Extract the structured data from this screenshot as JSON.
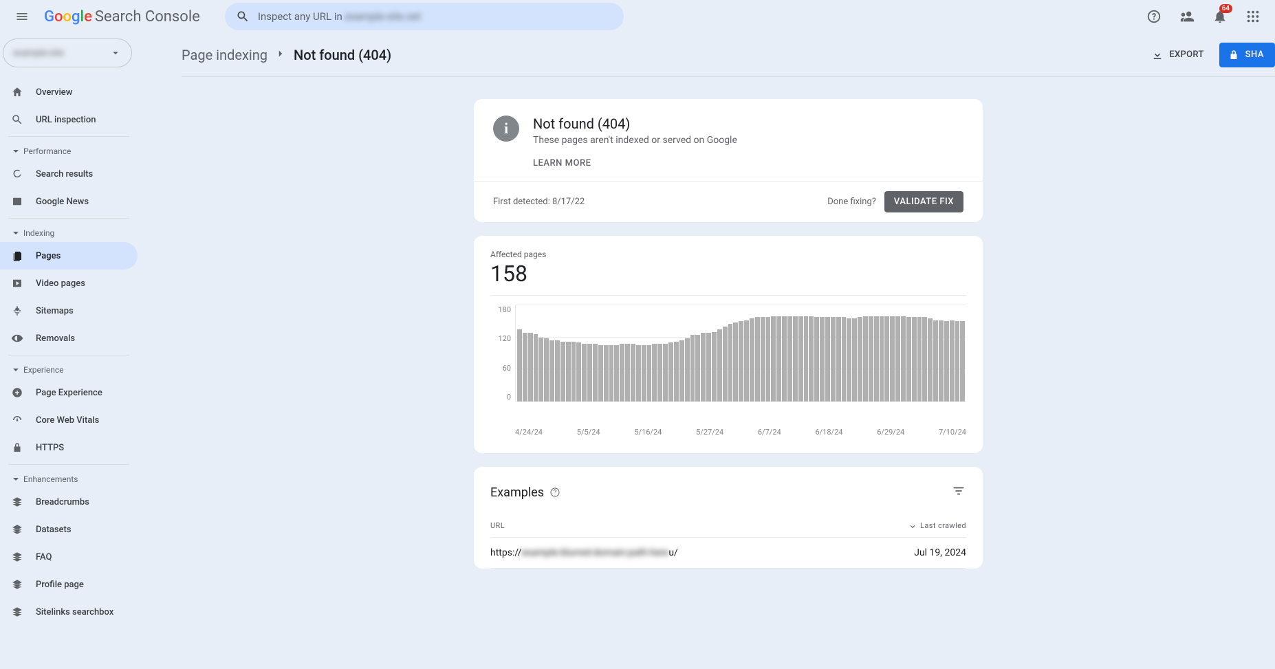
{
  "header": {
    "product_name": "Search Console",
    "search_placeholder": "Inspect any URL in",
    "search_domain_blurred": "example-site.net",
    "notification_count": "64"
  },
  "property_selector": {
    "blurred_text": "example-site"
  },
  "sidebar": {
    "overview": "Overview",
    "url_inspection": "URL inspection",
    "section_performance": "Performance",
    "search_results": "Search results",
    "google_news": "Google News",
    "section_indexing": "Indexing",
    "pages": "Pages",
    "video_pages": "Video pages",
    "sitemaps": "Sitemaps",
    "removals": "Removals",
    "section_experience": "Experience",
    "page_experience": "Page Experience",
    "core_web_vitals": "Core Web Vitals",
    "https": "HTTPS",
    "section_enhancements": "Enhancements",
    "breadcrumbs": "Breadcrumbs",
    "datasets": "Datasets",
    "faq": "FAQ",
    "profile_page": "Profile page",
    "sitelinks_searchbox": "Sitelinks searchbox"
  },
  "breadcrumb": {
    "parent": "Page indexing",
    "current": "Not found (404)",
    "export": "EXPORT",
    "share": "SHA"
  },
  "status_card": {
    "title": "Not found (404)",
    "subtitle": "These pages aren't indexed or served on Google",
    "learn_more": "LEARN MORE",
    "first_detected_label": "First detected: ",
    "first_detected_date": "8/17/22",
    "done_fixing": "Done fixing?",
    "validate": "VALIDATE FIX"
  },
  "chart_card": {
    "label": "Affected pages",
    "value": "158"
  },
  "chart_data": {
    "type": "bar",
    "title": "Affected pages",
    "ylabel": "",
    "xlabel": "",
    "ylim": [
      0,
      180
    ],
    "y_ticks": [
      "180",
      "120",
      "60",
      "0"
    ],
    "x_ticks": [
      "4/24/24",
      "5/5/24",
      "5/16/24",
      "5/27/24",
      "6/7/24",
      "6/18/24",
      "6/29/24",
      "7/10/24"
    ],
    "values": [
      135,
      128,
      128,
      126,
      120,
      118,
      115,
      115,
      112,
      112,
      112,
      110,
      108,
      108,
      108,
      105,
      105,
      105,
      105,
      108,
      108,
      108,
      105,
      105,
      105,
      108,
      108,
      108,
      110,
      112,
      115,
      118,
      125,
      125,
      128,
      128,
      130,
      135,
      140,
      145,
      148,
      150,
      152,
      155,
      158,
      158,
      158,
      160,
      160,
      160,
      160,
      160,
      160,
      160,
      160,
      158,
      158,
      158,
      158,
      158,
      158,
      155,
      155,
      158,
      160,
      160,
      160,
      160,
      160,
      160,
      160,
      160,
      158,
      158,
      158,
      158,
      155,
      152,
      152,
      150,
      152,
      150,
      150
    ]
  },
  "examples": {
    "title": "Examples",
    "col_url": "URL",
    "col_crawled": "Last crawled",
    "rows": [
      {
        "url_prefix": "https://",
        "url_blur": "example-blurred-domain-path-here",
        "url_suffix": "u/",
        "date": "Jul 19, 2024"
      }
    ]
  }
}
